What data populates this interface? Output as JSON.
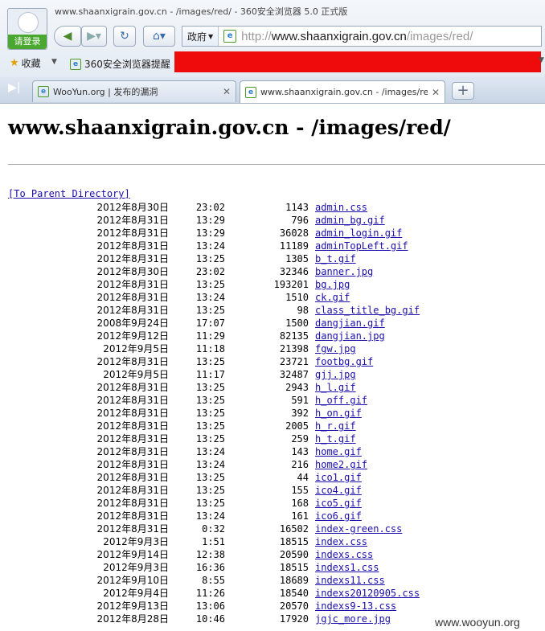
{
  "browser": {
    "window_title": "www.shaanxigrain.gov.cn - /images/red/ - 360安全浏览器 5.0 正式版",
    "login_label": "请登录",
    "address_zone": "政府",
    "address_url_prefix": "http://",
    "address_url_host": "www.shaanxigrain.gov.cn",
    "address_url_path": "/images/red/",
    "favorites_label": "收藏",
    "bookmark_item": "360安全浏览器提醒",
    "tabs": [
      {
        "label": "WooYun.org | 发布的漏洞",
        "active": false
      },
      {
        "label": "www.shaanxigrain.gov.cn - /images/red/",
        "active": true
      }
    ]
  },
  "page": {
    "title": "www.shaanxigrain.gov.cn - /images/red/",
    "parent_link": "[To Parent Directory]"
  },
  "files": [
    {
      "date": "2012年8月30日",
      "time": "23:02",
      "size": "1143",
      "name": "admin.css"
    },
    {
      "date": "2012年8月31日",
      "time": "13:29",
      "size": "796",
      "name": "admin_bg.gif"
    },
    {
      "date": "2012年8月31日",
      "time": "13:29",
      "size": "36028",
      "name": "admin_login.gif"
    },
    {
      "date": "2012年8月31日",
      "time": "13:24",
      "size": "11189",
      "name": "adminTopLeft.gif"
    },
    {
      "date": "2012年8月31日",
      "time": "13:25",
      "size": "1305",
      "name": "b_t.gif"
    },
    {
      "date": "2012年8月30日",
      "time": "23:02",
      "size": "32346",
      "name": "banner.jpg"
    },
    {
      "date": "2012年8月31日",
      "time": "13:25",
      "size": "193201",
      "name": "bg.jpg"
    },
    {
      "date": "2012年8月31日",
      "time": "13:24",
      "size": "1510",
      "name": "ck.gif"
    },
    {
      "date": "2012年8月31日",
      "time": "13:25",
      "size": "98",
      "name": "class_title_bg.gif"
    },
    {
      "date": "2008年9月24日",
      "time": "17:07",
      "size": "1500",
      "name": "dangjian.gif"
    },
    {
      "date": "2012年9月12日",
      "time": "11:29",
      "size": "82135",
      "name": "dangjian.jpg"
    },
    {
      "date": "2012年9月5日",
      "time": "11:18",
      "size": "21398",
      "name": "fgw.jpg"
    },
    {
      "date": "2012年8月31日",
      "time": "13:25",
      "size": "23721",
      "name": "footbg.gif"
    },
    {
      "date": "2012年9月5日",
      "time": "11:17",
      "size": "32487",
      "name": "gjj.jpg"
    },
    {
      "date": "2012年8月31日",
      "time": "13:25",
      "size": "2943",
      "name": "h_l.gif"
    },
    {
      "date": "2012年8月31日",
      "time": "13:25",
      "size": "591",
      "name": "h_off.gif"
    },
    {
      "date": "2012年8月31日",
      "time": "13:25",
      "size": "392",
      "name": "h_on.gif"
    },
    {
      "date": "2012年8月31日",
      "time": "13:25",
      "size": "2005",
      "name": "h_r.gif"
    },
    {
      "date": "2012年8月31日",
      "time": "13:25",
      "size": "259",
      "name": "h_t.gif"
    },
    {
      "date": "2012年8月31日",
      "time": "13:24",
      "size": "143",
      "name": "home.gif"
    },
    {
      "date": "2012年8月31日",
      "time": "13:24",
      "size": "216",
      "name": "home2.gif"
    },
    {
      "date": "2012年8月31日",
      "time": "13:25",
      "size": "44",
      "name": "ico1.gif"
    },
    {
      "date": "2012年8月31日",
      "time": "13:25",
      "size": "155",
      "name": "ico4.gif"
    },
    {
      "date": "2012年8月31日",
      "time": "13:25",
      "size": "168",
      "name": "ico5.gif"
    },
    {
      "date": "2012年8月31日",
      "time": "13:24",
      "size": "161",
      "name": "ico6.gif"
    },
    {
      "date": "2012年8月31日",
      "time": "0:32",
      "size": "16502",
      "name": "index-green.css"
    },
    {
      "date": "2012年9月3日",
      "time": "1:51",
      "size": "18515",
      "name": "index.css"
    },
    {
      "date": "2012年9月14日",
      "time": "12:38",
      "size": "20590",
      "name": "indexs.css"
    },
    {
      "date": "2012年9月3日",
      "time": "16:36",
      "size": "18515",
      "name": "indexs1.css"
    },
    {
      "date": "2012年9月10日",
      "time": "8:55",
      "size": "18689",
      "name": "indexs11.css"
    },
    {
      "date": "2012年9月4日",
      "time": "11:26",
      "size": "18540",
      "name": "indexs20120905.css"
    },
    {
      "date": "2012年9月13日",
      "time": "13:06",
      "size": "20570",
      "name": "indexs9-13.css"
    },
    {
      "date": "2012年8月28日",
      "time": "10:46",
      "size": "17920",
      "name": "jgjc_more.jpg"
    }
  ],
  "watermark": "www.wooyun.org",
  "colors": {
    "link": "#1a0dab",
    "redaction": "#ef0b0b",
    "login_green": "#4aa72f"
  }
}
